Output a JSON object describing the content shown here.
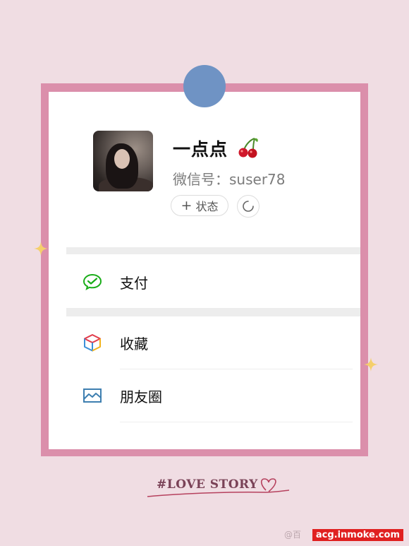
{
  "profile": {
    "name": "一点点",
    "wechat_id": "微信号：suser78",
    "status_button": "状态",
    "status_plus": "+"
  },
  "menu": {
    "pay": "支付",
    "favorites": "收藏",
    "moments": "朋友圈"
  },
  "decoration": {
    "tagline": "#LOVE STORY"
  },
  "watermark": {
    "site": "acg.inmoke.com",
    "faint_text": "@百"
  },
  "colors": {
    "background": "#f0dde3",
    "frame": "#db8fab",
    "pin": "#6f93c4",
    "pay_icon": "#1aad19",
    "moments_icon": "#3e7fb0"
  }
}
